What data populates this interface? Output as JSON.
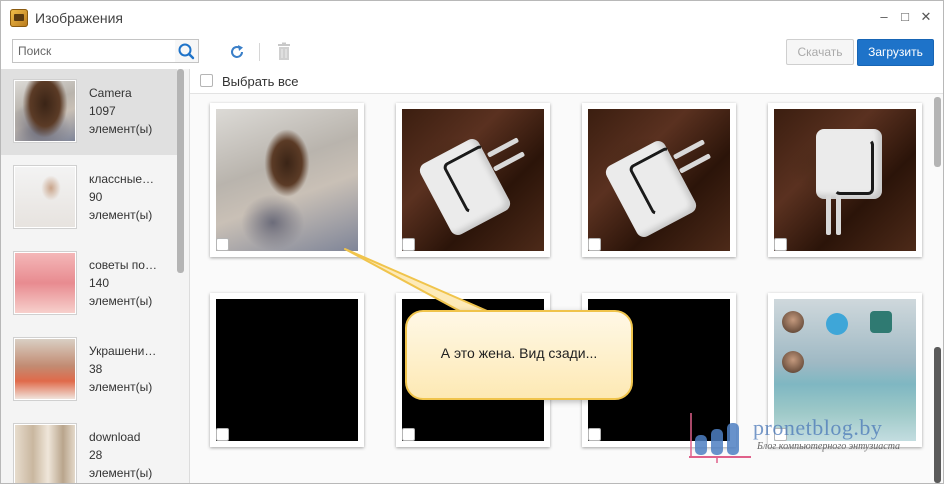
{
  "window": {
    "title": "Изображения",
    "minimize_glyph": "–",
    "maximize_glyph": "□",
    "close_glyph": "✕"
  },
  "toolbar": {
    "search_placeholder": "Поиск",
    "search_icon": "search-icon",
    "refresh_icon": "refresh-icon",
    "delete_icon": "trash-icon",
    "download_label": "Скачать",
    "upload_label": "Загрузить"
  },
  "sidebar": {
    "albums": [
      {
        "name": "Camera",
        "count": "1097",
        "unit": "элемент(ы)"
      },
      {
        "name": "классные…",
        "count": "90",
        "unit": "элемент(ы)"
      },
      {
        "name": "советы по…",
        "count": "140",
        "unit": "элемент(ы)"
      },
      {
        "name": "Украшени…",
        "count": "38",
        "unit": "элемент(ы)"
      },
      {
        "name": "download",
        "count": "28",
        "unit": "элемент(ы)"
      }
    ]
  },
  "main": {
    "select_all_label": "Выбрать все"
  },
  "callout": {
    "text": "А это жена. Вид сзади..."
  },
  "watermark": {
    "site": "pronetblog.by",
    "tagline": "Блог компьютерного энтузиаста"
  },
  "colors": {
    "accent": "#1e73c9",
    "callout_border": "#f0c44c",
    "active_album_bg": "#e0e0e0"
  }
}
